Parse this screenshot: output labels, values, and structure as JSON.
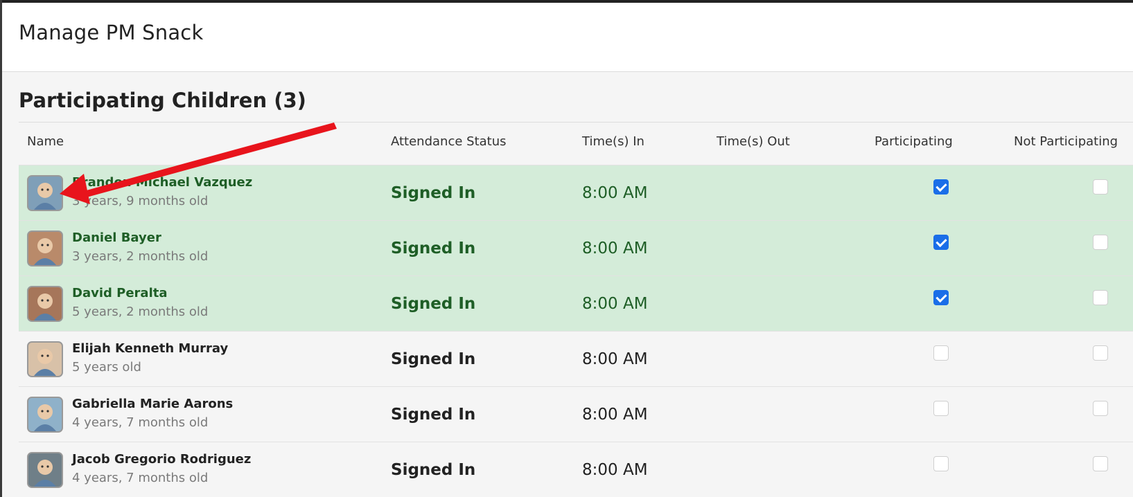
{
  "modal": {
    "title": "Manage PM Snack"
  },
  "section": {
    "title": "Participating Children (3)"
  },
  "table": {
    "headers": {
      "name": "Name",
      "attendance": "Attendance Status",
      "time_in": "Time(s) In",
      "time_out": "Time(s) Out",
      "participating": "Participating",
      "not_participating": "Not Participating"
    },
    "rows": [
      {
        "name": "Brandon Michael Vazquez",
        "age": "3 years, 9 months old",
        "status": "Signed In",
        "time_in": "8:00 AM",
        "time_out": "",
        "participating": true,
        "not_participating": false,
        "highlight": true
      },
      {
        "name": "Daniel Bayer",
        "age": "3 years, 2 months old",
        "status": "Signed In",
        "time_in": "8:00 AM",
        "time_out": "",
        "participating": true,
        "not_participating": false,
        "highlight": true
      },
      {
        "name": "David Peralta",
        "age": "5 years, 2 months old",
        "status": "Signed In",
        "time_in": "8:00 AM",
        "time_out": "",
        "participating": true,
        "not_participating": false,
        "highlight": true
      },
      {
        "name": "Elijah Kenneth Murray",
        "age": "5 years old",
        "status": "Signed In",
        "time_in": "8:00 AM",
        "time_out": "",
        "participating": false,
        "not_participating": false,
        "highlight": false
      },
      {
        "name": "Gabriella Marie Aarons",
        "age": "4 years, 7 months old",
        "status": "Signed In",
        "time_in": "8:00 AM",
        "time_out": "",
        "participating": false,
        "not_participating": false,
        "highlight": false
      },
      {
        "name": "Jacob Gregorio Rodriguez",
        "age": "4 years, 7 months old",
        "status": "Signed In",
        "time_in": "8:00 AM",
        "time_out": "",
        "participating": false,
        "not_participating": false,
        "highlight": false
      }
    ]
  },
  "colors": {
    "highlight_row": "#d4ecd9",
    "highlight_text": "#1e5e26",
    "checkbox_checked": "#1a6ee8",
    "annotation_arrow": "#e8141c"
  }
}
